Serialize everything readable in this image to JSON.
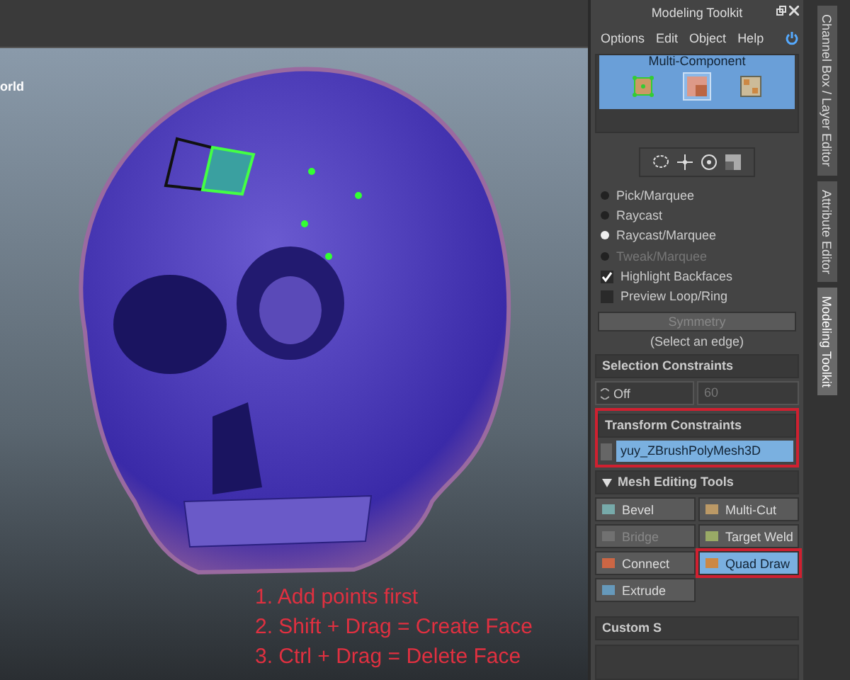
{
  "viewport": {
    "label": "orld",
    "instructions": [
      "1. Add points first",
      "2. Shift + Drag = Create Face",
      "3. Ctrl + Drag = Delete Face"
    ]
  },
  "panel": {
    "title": "Modeling Toolkit",
    "menu": [
      "Options",
      "Edit",
      "Object",
      "Help"
    ],
    "component_header": "Multi-Component",
    "components": [
      {
        "kind": "vertex",
        "selected": false
      },
      {
        "kind": "face",
        "selected": true
      },
      {
        "kind": "uv",
        "selected": false
      }
    ],
    "select_modes": [
      {
        "label": "Pick/Marquee",
        "selected": false,
        "disabled": false
      },
      {
        "label": "Raycast",
        "selected": false,
        "disabled": false
      },
      {
        "label": "Raycast/Marquee",
        "selected": true,
        "disabled": false
      },
      {
        "label": "Tweak/Marquee",
        "selected": false,
        "disabled": true
      }
    ],
    "options": [
      {
        "label": "Highlight Backfaces",
        "checked": true
      },
      {
        "label": "Preview Loop/Ring",
        "checked": false
      }
    ],
    "symmetry_button": {
      "label": "Symmetry",
      "disabled": true
    },
    "symmetry_hint": "(Select an edge)",
    "selection_constraints": {
      "title": "Selection Constraints",
      "dropdown": "Off",
      "value": "60"
    },
    "transform_constraints": {
      "title": "Transform Constraints",
      "highlighted": true,
      "value": "yuy_ZBrushPolyMesh3D"
    },
    "mesh_tools": {
      "title": "Mesh Editing Tools",
      "expanded": true,
      "tools": [
        {
          "label": "Bevel",
          "kind": "bevel",
          "disabled": false,
          "selected": false
        },
        {
          "label": "Multi-Cut",
          "kind": "cut",
          "disabled": false,
          "selected": false
        },
        {
          "label": "Bridge",
          "kind": "bridge",
          "disabled": true,
          "selected": false
        },
        {
          "label": "Target Weld",
          "kind": "weld",
          "disabled": false,
          "selected": false
        },
        {
          "label": "Connect",
          "kind": "connect",
          "disabled": false,
          "selected": false
        },
        {
          "label": "Quad Draw",
          "kind": "quad",
          "disabled": false,
          "selected": true
        },
        {
          "label": "Extrude",
          "kind": "extrude",
          "disabled": false,
          "selected": false
        }
      ]
    },
    "custom_section": "Custom S"
  },
  "side_tabs": [
    {
      "label": "Channel Box / Layer Editor",
      "selected": false
    },
    {
      "label": "Attribute Editor",
      "selected": false
    },
    {
      "label": "Modeling Toolkit",
      "selected": true
    }
  ]
}
